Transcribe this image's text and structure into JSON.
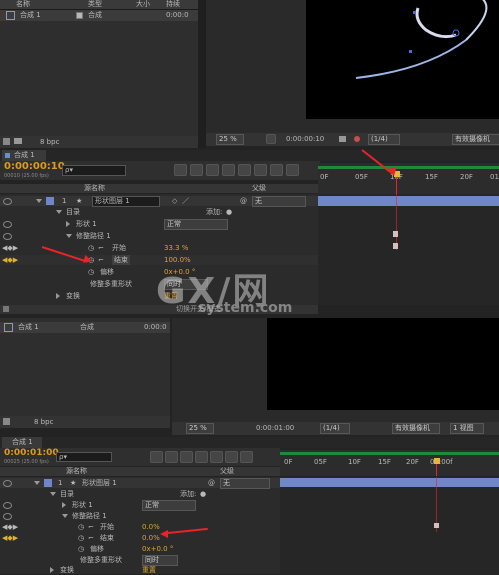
{
  "top": {
    "project_panel": {
      "col_name": "名称",
      "col_type": "类型",
      "col_size": "大小",
      "col_duration": "持续",
      "item_name": "合成 1",
      "item_type": "合成",
      "item_duration": "0:00:0",
      "bpc": "8 bpc"
    },
    "viewer": {
      "zoom": "25 %",
      "timecode": "0:00:00:10",
      "resolution": "(1/4)",
      "camera": "有效摄像机"
    },
    "timeline": {
      "tab_label": "合成 1",
      "timecode": "0:00:00:10",
      "timecode_sub": "00010 (25.00 fps)",
      "search_placeholder": "ρ▾",
      "col_layer_name": "源名称",
      "col_parent": "父级",
      "parent_value": "无",
      "ruler_ticks": [
        "0F",
        "05F",
        "10F",
        "15F",
        "20F",
        "01"
      ],
      "layers": {
        "shape_layer_num": "1",
        "shape_layer_name": "形状图层 1",
        "contents": "目录",
        "add_label": "添加:",
        "shape1": "形状 1",
        "shape1_mode": "正常",
        "trim_paths": "修整路径 1",
        "start_label": "开始",
        "start_value": "33.3 %",
        "end_label": "结束",
        "end_value": "100.0%",
        "offset_label": "偏移",
        "offset_value": "0x+0.0 °",
        "trim_multiple_label": "修整多重形状",
        "trim_multiple_value": "同时",
        "transform_label": "变换",
        "transform_value": "重置"
      },
      "footer_label": "切换开关/模式"
    }
  },
  "bottom": {
    "project_panel": {
      "item_name": "合成 1",
      "item_type": "合成",
      "item_duration": "0:00:0",
      "bpc": "8 bpc"
    },
    "viewer": {
      "zoom": "25 %",
      "timecode": "0:00:01:00",
      "resolution": "(1/4)",
      "camera": "有效摄像机",
      "view_count": "1 视图"
    },
    "timeline": {
      "tab_label": "合成 1",
      "timecode": "0:00:01:00",
      "timecode_sub": "00025 (25.00 fps)",
      "search_placeholder": "ρ▾",
      "col_layer_name": "源名称",
      "col_parent": "父级",
      "parent_value": "无",
      "ruler_ticks": [
        "0F",
        "05F",
        "10F",
        "15F",
        "20F",
        "01:00f"
      ],
      "layers": {
        "shape_layer_num": "1",
        "shape_layer_name": "形状图层 1",
        "contents": "目录",
        "add_label": "添加:",
        "shape1": "形状 1",
        "shape1_mode": "正常",
        "trim_paths": "修整路径 1",
        "start_label": "开始",
        "start_value": "0.0%",
        "end_label": "结束",
        "end_value": "0.0%",
        "offset_label": "偏移",
        "offset_value": "0x+0.0 °",
        "trim_multiple_label": "修整多重形状",
        "trim_multiple_value": "同时",
        "transform_label": "变换",
        "transform_value": "重置"
      }
    }
  },
  "watermark": {
    "brand": "GX/网",
    "url": "system.com"
  },
  "colors": {
    "timecode": "#e09a1c",
    "property_value": "#d8a23a",
    "layer_bar": "#6f86c9",
    "arrow": "#e8232a",
    "ruler_bar": "#1e8a3a",
    "canvas": "#000000"
  }
}
